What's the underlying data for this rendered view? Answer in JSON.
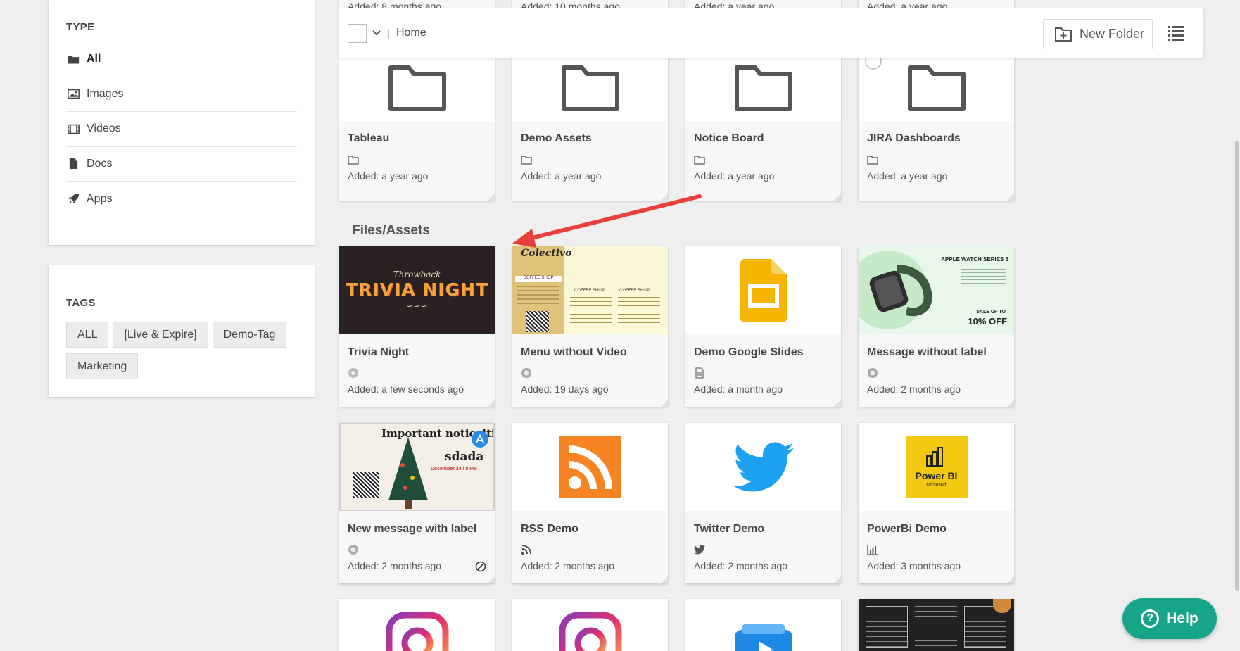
{
  "sidebar": {
    "type_title": "TYPE",
    "types": [
      {
        "label": "All",
        "icon": "folder-icon",
        "active": true
      },
      {
        "label": "Images",
        "icon": "image-icon"
      },
      {
        "label": "Videos",
        "icon": "film-icon"
      },
      {
        "label": "Docs",
        "icon": "document-icon"
      },
      {
        "label": "Apps",
        "icon": "rocket-icon"
      }
    ],
    "tags_title": "TAGS",
    "tags": [
      "ALL",
      "[Live & Expire]",
      "Demo-Tag",
      "Marketing"
    ]
  },
  "toolbar": {
    "breadcrumb": "Home",
    "new_folder_label": "New Folder"
  },
  "top_partial_added": [
    "Added: 8 months ago",
    "Added: 10 months ago",
    "Added: a year ago",
    "Added: a year ago"
  ],
  "folders": [
    {
      "title": "Tableau",
      "added": "Added: a year ago"
    },
    {
      "title": "Demo Assets",
      "added": "Added: a year ago"
    },
    {
      "title": "Notice Board",
      "added": "Added: a year ago"
    },
    {
      "title": "JIRA Dashboards",
      "added": "Added: a year ago"
    }
  ],
  "section_heading": "Files/Assets",
  "files": [
    {
      "title": "Trivia Night",
      "added": "Added: a few seconds ago",
      "thumb_text": {
        "small": "Throwback",
        "big": "TRIVIA NIGHT"
      }
    },
    {
      "title": "Menu without Video",
      "added": "Added: 19 days ago",
      "thumb_text": {
        "brand": "Colectivo",
        "left_heading": "COFFEE SHOP",
        "col1": "COFFEE SHOP",
        "col2": "COFFEE SHOP"
      }
    },
    {
      "title": "Demo Google Slides",
      "added": "Added: a month ago"
    },
    {
      "title": "Message without label",
      "added": "Added: 2 months ago",
      "thumb_text": {
        "heading": "APPLE WATCH SERIES 5",
        "sale": "SALE UP TO",
        "off": "10% OFF"
      }
    },
    {
      "title": "New message with label",
      "added": "Added: 2 months ago",
      "thumb_text": {
        "heading": "Important noticaitio",
        "sub": "sdada",
        "date": "December 24 / 8 PM"
      }
    },
    {
      "title": "RSS Demo",
      "added": "Added: 2 months ago"
    },
    {
      "title": "Twitter Demo",
      "added": "Added: 2 months ago"
    },
    {
      "title": "PowerBi Demo",
      "added": "Added: 3 months ago",
      "thumb_text": {
        "brand": "Power BI",
        "sub": "Microsoft"
      }
    }
  ],
  "help_label": "Help",
  "colors": {
    "help": "#17a589",
    "arrow": "#e8413d",
    "slides": "#f4b400",
    "rss": "#f78422",
    "twitter": "#1da1f2",
    "powerbi": "#f2c811"
  }
}
